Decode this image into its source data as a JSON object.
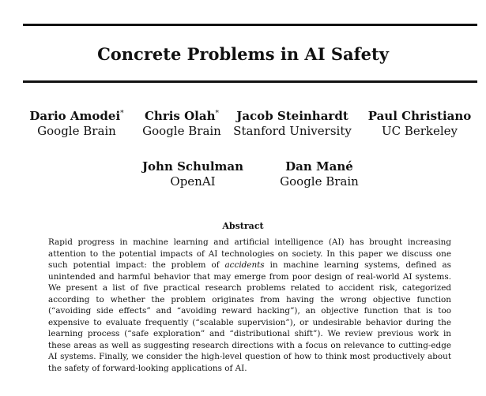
{
  "paper": {
    "title": "Concrete Problems in AI Safety",
    "authors": [
      {
        "name": "Dario Amodei",
        "mark": "*",
        "affiliation": "Google Brain"
      },
      {
        "name": "Chris Olah",
        "mark": "*",
        "affiliation": "Google Brain"
      },
      {
        "name": "Jacob Steinhardt",
        "mark": "",
        "affiliation": "Stanford University"
      },
      {
        "name": "Paul Christiano",
        "mark": "",
        "affiliation": "UC Berkeley"
      },
      {
        "name": "John Schulman",
        "mark": "",
        "affiliation": "OpenAI"
      },
      {
        "name": "Dan Mané",
        "mark": "",
        "affiliation": "Google Brain"
      }
    ],
    "abstract_heading": "Abstract",
    "abstract": {
      "part1": "Rapid progress in machine learning and artificial intelligence (AI) has brought increasing attention to the potential impacts of AI technologies on society. In this paper we discuss one such potential impact: the problem of ",
      "emph": "accidents",
      "part2": " in machine learning systems, defined as unintended and harmful behavior that may emerge from poor design of real-world AI systems. We present a list of five practical research problems related to accident risk, categorized according to whether the problem originates from having the wrong objective function (“avoiding side effects” and “avoiding reward hacking”), an objective function that is too expensive to evaluate frequently (“scalable supervision”), or undesirable behavior during the learning process (“safe exploration” and “distributional shift”). We review previous work in these areas as well as suggesting research directions with a focus on relevance to cutting-edge AI systems. Finally, we consider the high-level question of how to think most productively about the safety of forward-looking applications of AI."
    }
  }
}
